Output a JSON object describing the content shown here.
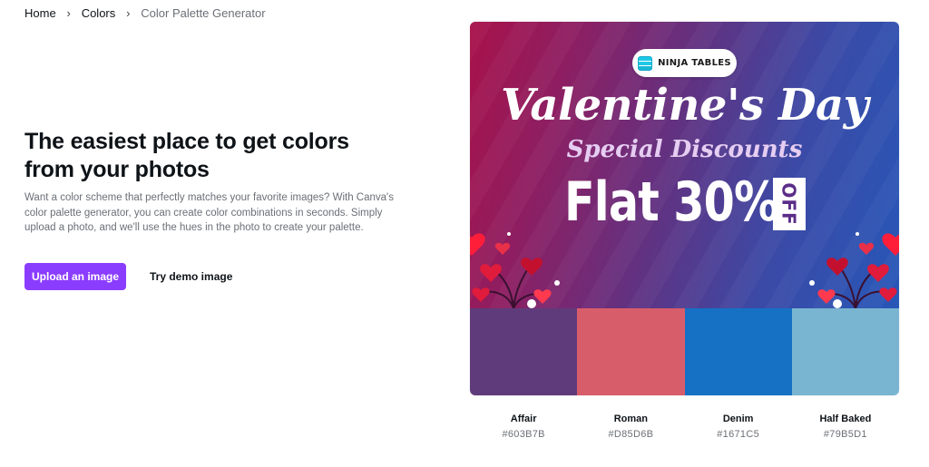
{
  "breadcrumb": {
    "items": [
      "Home",
      "Colors"
    ],
    "current": "Color Palette Generator"
  },
  "hero": {
    "title": "The easiest place to get colors from your photos",
    "description": "Want a color scheme that perfectly matches your favorite images? With Canva's color palette generator, you can create color combinations in seconds. Simply upload a photo, and we'll use the hues in the photo to create your palette.",
    "upload_label": "Upload an image",
    "demo_label": "Try demo image"
  },
  "accent_color": "#8B3DFF",
  "photo": {
    "brand_logo_text": "NINJA TABLES",
    "headline": "Valentine's Day",
    "subheadline": "Special Discounts",
    "offer": "Flat 30%",
    "offer_tag": "OFF"
  },
  "palette": [
    {
      "name": "Affair",
      "hex": "#603B7B"
    },
    {
      "name": "Roman",
      "hex": "#D85D6B"
    },
    {
      "name": "Denim",
      "hex": "#1671C5"
    },
    {
      "name": "Half Baked",
      "hex": "#79B5D1"
    }
  ]
}
